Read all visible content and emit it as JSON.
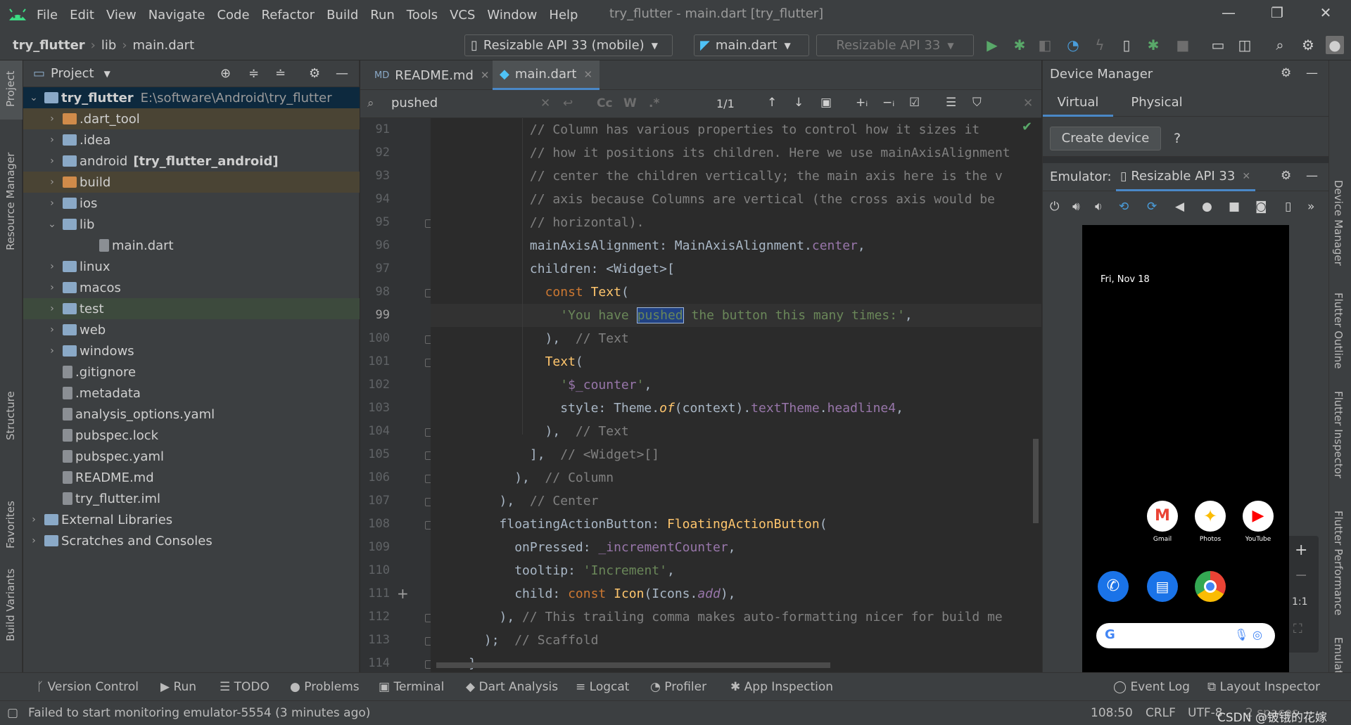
{
  "menubar": {
    "items": [
      "File",
      "Edit",
      "View",
      "Navigate",
      "Code",
      "Refactor",
      "Build",
      "Run",
      "Tools",
      "VCS",
      "Window",
      "Help"
    ],
    "window_title": "try_flutter - main.dart [try_flutter]"
  },
  "navbar": {
    "breadcrumbs": [
      "try_flutter",
      "lib",
      "main.dart"
    ],
    "device_combo": "Resizable API 33 (mobile)",
    "config_combo": "main.dart",
    "target_combo": "Resizable API 33"
  },
  "left_stripe": [
    "Project",
    "Resource Manager",
    "Structure",
    "Favorites",
    "Build Variants"
  ],
  "project_panel": {
    "title": "Project",
    "root": {
      "name": "try_flutter",
      "path": "E:\\software\\Android\\try_flutter"
    },
    "items": [
      {
        "label": ".dart_tool",
        "kind": "folder-orange"
      },
      {
        "label": ".idea",
        "kind": "folder"
      },
      {
        "label": "android",
        "extra": "[try_flutter_android]",
        "kind": "folder"
      },
      {
        "label": "build",
        "kind": "folder-orange"
      },
      {
        "label": "ios",
        "kind": "folder"
      },
      {
        "label": "lib",
        "kind": "folder"
      },
      {
        "label": "main.dart",
        "kind": "file"
      },
      {
        "label": "linux",
        "kind": "folder"
      },
      {
        "label": "macos",
        "kind": "folder"
      },
      {
        "label": "test",
        "kind": "folder"
      },
      {
        "label": "web",
        "kind": "folder"
      },
      {
        "label": "windows",
        "kind": "folder"
      },
      {
        "label": ".gitignore",
        "kind": "file"
      },
      {
        "label": ".metadata",
        "kind": "file"
      },
      {
        "label": "analysis_options.yaml",
        "kind": "file"
      },
      {
        "label": "pubspec.lock",
        "kind": "file"
      },
      {
        "label": "pubspec.yaml",
        "kind": "file"
      },
      {
        "label": "README.md",
        "kind": "file"
      },
      {
        "label": "try_flutter.iml",
        "kind": "file"
      },
      {
        "label": "External Libraries",
        "kind": "lib"
      },
      {
        "label": "Scratches and Consoles",
        "kind": "scratch"
      }
    ]
  },
  "editor": {
    "tabs": [
      "README.md",
      "main.dart"
    ],
    "active_tab": "main.dart",
    "find": {
      "query": "pushed",
      "count": "1/1"
    },
    "line_numbers": [
      "91",
      "92",
      "93",
      "94",
      "95",
      "96",
      "97",
      "98",
      "99",
      "100",
      "101",
      "102",
      "103",
      "104",
      "105",
      "106",
      "107",
      "108",
      "109",
      "110",
      "111",
      "112",
      "113",
      "114"
    ],
    "current_line": "99"
  },
  "device_manager": {
    "title": "Device Manager",
    "tabs": [
      "Virtual",
      "Physical"
    ],
    "create_button": "Create device",
    "help": "?",
    "emulator_label": "Emulator:",
    "emulator_tab": "Resizable API 33",
    "phone": {
      "date": "Fri, Nov 18",
      "apps_row1": [
        "Gmail",
        "Photos",
        "YouTube"
      ],
      "zoom_ratio": "1:1"
    }
  },
  "right_stripe": [
    "Device Manager",
    "Flutter Outline",
    "Flutter Inspector",
    "Flutter Performance",
    "Emulator"
  ],
  "bottom_tools": [
    "Version Control",
    "Run",
    "TODO",
    "Problems",
    "Terminal",
    "Dart Analysis",
    "Logcat",
    "Profiler",
    "App Inspection",
    "Event Log",
    "Layout Inspector"
  ],
  "status": {
    "message": "Failed to start monitoring emulator-5554 (3 minutes ago)",
    "position": "108:50",
    "line_sep": "CRLF",
    "encoding": "UTF-8",
    "indent": "2 spaces",
    "watermark": "CSDN @铍锇的花嫁"
  }
}
